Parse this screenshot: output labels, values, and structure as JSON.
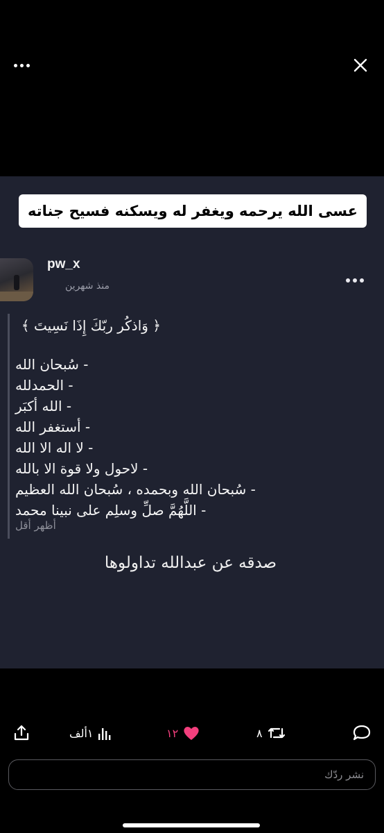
{
  "post": {
    "caption": "عسى الله يرحمه ويغفر له ويسكنه فسيح جناته",
    "username": "pw_x",
    "time_ago": "منذ شهرين",
    "verse": "﴿ وَاذكُر ربّكَ إِذَا نَسِيتَ ﴾",
    "dhikr": [
      "- سُبحان الله",
      "- الحمدلله",
      "- الله أكبَر",
      "- أستغفر الله",
      "- لا اله الا الله",
      "- لاحول ولا قوة الا بالله",
      "- سُبحان الله وبحمده ، سُبحان الله العظيم",
      "- اللَّهُمَّ صلِّ وسلِم على نبينا محمد"
    ],
    "show_less": "أظهر أقل",
    "footer_note": "صدقه عن عبدالله تداولوها"
  },
  "actions": {
    "views": "١ألف",
    "likes": "١٢",
    "reposts": "٨"
  },
  "reply": {
    "placeholder": "نشر ردّك"
  },
  "icons": {
    "top_left": "more-horizontal-icon",
    "top_right": "close-icon",
    "post_menu": "more-horizontal-icon",
    "share": "share-icon",
    "views": "bar-chart-icon",
    "likes": "heart-icon",
    "reposts": "repost-icon",
    "reply": "reply-bubble-icon"
  },
  "colors": {
    "background": "#000000",
    "photo_background": "#1f2230",
    "like_accent": "#f33f7d",
    "muted_text": "#8e8e93"
  }
}
